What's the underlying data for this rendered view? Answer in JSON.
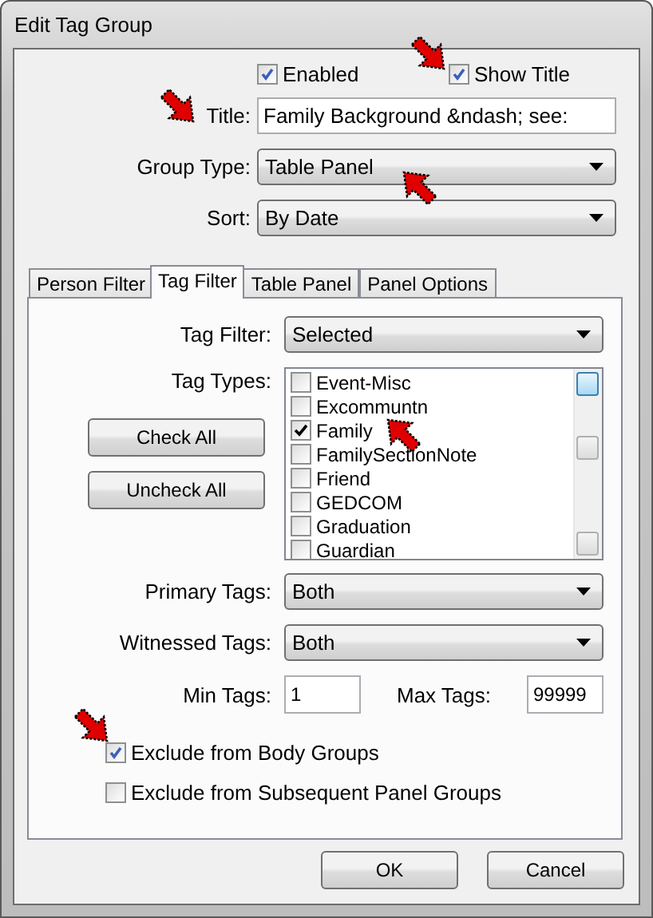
{
  "window": {
    "title": "Edit Tag Group"
  },
  "options": [
    {
      "label": "Enabled",
      "checked": true
    },
    {
      "label": "Show Title",
      "checked": true
    }
  ],
  "title_field": {
    "label": "Title:",
    "value": "Family Background &ndash; see:"
  },
  "group_type": {
    "label": "Group Type:",
    "value": "Table Panel"
  },
  "sort": {
    "label": "Sort:",
    "value": "By Date"
  },
  "tabs": [
    {
      "label": "Person Filter",
      "selected": false
    },
    {
      "label": "Tag Filter",
      "selected": true
    },
    {
      "label": "Table Panel",
      "selected": false
    },
    {
      "label": "Panel Options",
      "selected": false
    }
  ],
  "tag_filter": {
    "label": "Tag Filter:",
    "value": "Selected"
  },
  "tag_types": {
    "label": "Tag Types:",
    "items": [
      {
        "label": "Event-Misc",
        "checked": false
      },
      {
        "label": "Excommuntn",
        "checked": false
      },
      {
        "label": "Family",
        "checked": true
      },
      {
        "label": "FamilySectionNote",
        "checked": false
      },
      {
        "label": "Friend",
        "checked": false
      },
      {
        "label": "GEDCOM",
        "checked": false
      },
      {
        "label": "Graduation",
        "checked": false
      },
      {
        "label": "Guardian",
        "checked": false
      }
    ]
  },
  "list_buttons": [
    "Check All",
    "Uncheck All"
  ],
  "primary_tags": {
    "label": "Primary Tags:",
    "value": "Both"
  },
  "witnessed_tags": {
    "label": "Witnessed Tags:",
    "value": "Both"
  },
  "min_tags": {
    "label": "Min Tags:",
    "value": "1"
  },
  "max_tags": {
    "label": "Max Tags:",
    "value": "99999"
  },
  "exclusions": [
    {
      "label": "Exclude from Body Groups",
      "checked": true
    },
    {
      "label": "Exclude from Subsequent Panel Groups",
      "checked": false
    }
  ],
  "dialog_buttons": [
    "OK",
    "Cancel"
  ]
}
